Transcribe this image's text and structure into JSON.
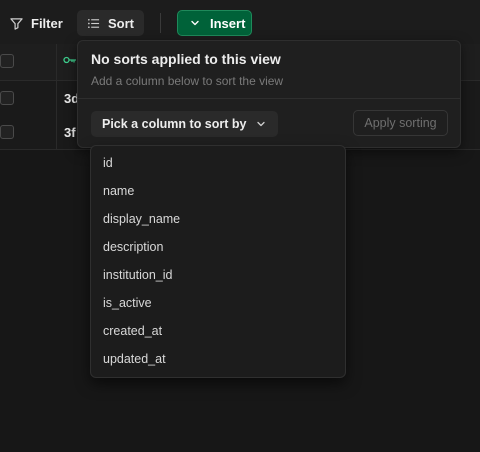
{
  "toolbar": {
    "filter_label": "Filter",
    "sort_label": "Sort",
    "insert_label": "Insert"
  },
  "grid": {
    "rows": [
      {
        "id_prefix": "3d"
      },
      {
        "id_prefix": "3f"
      }
    ]
  },
  "sort_popover": {
    "title": "No sorts applied to this view",
    "subtitle": "Add a column below to sort the view",
    "pick_label": "Pick a column to sort by",
    "apply_label": "Apply sorting"
  },
  "columns": [
    "id",
    "name",
    "display_name",
    "description",
    "institution_id",
    "is_active",
    "created_at",
    "updated_at"
  ],
  "colors": {
    "accent": "#006239",
    "key_icon": "#3ecf8e",
    "background": "#171717"
  }
}
